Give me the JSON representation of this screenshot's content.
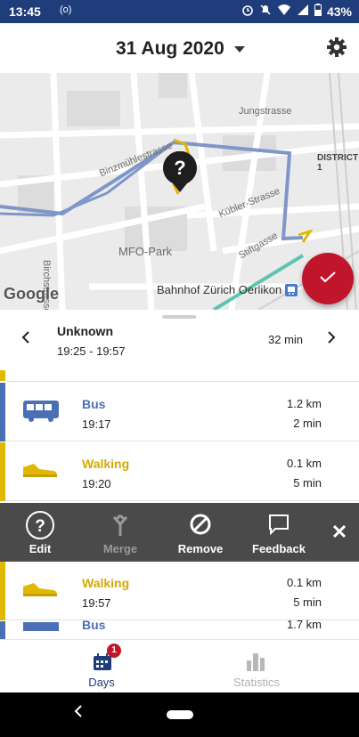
{
  "status_bar": {
    "time": "13:45",
    "battery": "43%"
  },
  "header": {
    "date": "31 Aug 2020"
  },
  "map": {
    "labels": {
      "jungstrasse": "Jungstrasse",
      "district": "DISTRICT 1",
      "binzmuhle": "Binzmühlestrasse",
      "kubler": "Kübler-Strasse",
      "mfo": "MFO-Park",
      "stiftgasse": "Stiftgasse",
      "birchstrasse": "Birchstrasse",
      "bahnhof": "Bahnhof Zürich Oerlikon",
      "google": "Google"
    },
    "unknown_marker": "?"
  },
  "summary": {
    "title": "Unknown",
    "time_range": "19:25 - 19:57",
    "duration": "32 min"
  },
  "legs": [
    {
      "mode": "Bus",
      "time": "19:17",
      "distance": "1.2 km",
      "duration": "2 min",
      "color": "#4a6fb5"
    },
    {
      "mode": "Walking",
      "time": "19:20",
      "distance": "0.1 km",
      "duration": "5 min",
      "color": "#e0b800"
    },
    {
      "mode": "Walking",
      "time": "19:57",
      "distance": "0.1 km",
      "duration": "5 min",
      "color": "#e0b800"
    },
    {
      "mode": "Bus",
      "time": "",
      "distance": "1.7 km",
      "duration": "",
      "color": "#4a6fb5"
    }
  ],
  "actions": {
    "edit": "Edit",
    "merge": "Merge",
    "remove": "Remove",
    "feedback": "Feedback"
  },
  "bottom_nav": {
    "days": "Days",
    "days_badge": "1",
    "statistics": "Statistics"
  },
  "colors": {
    "accent": "#c0152a",
    "status_bar": "#1f3d7a",
    "bus": "#4a6fb5",
    "walking": "#e0b800",
    "active_nav": "#1f3d7a"
  }
}
